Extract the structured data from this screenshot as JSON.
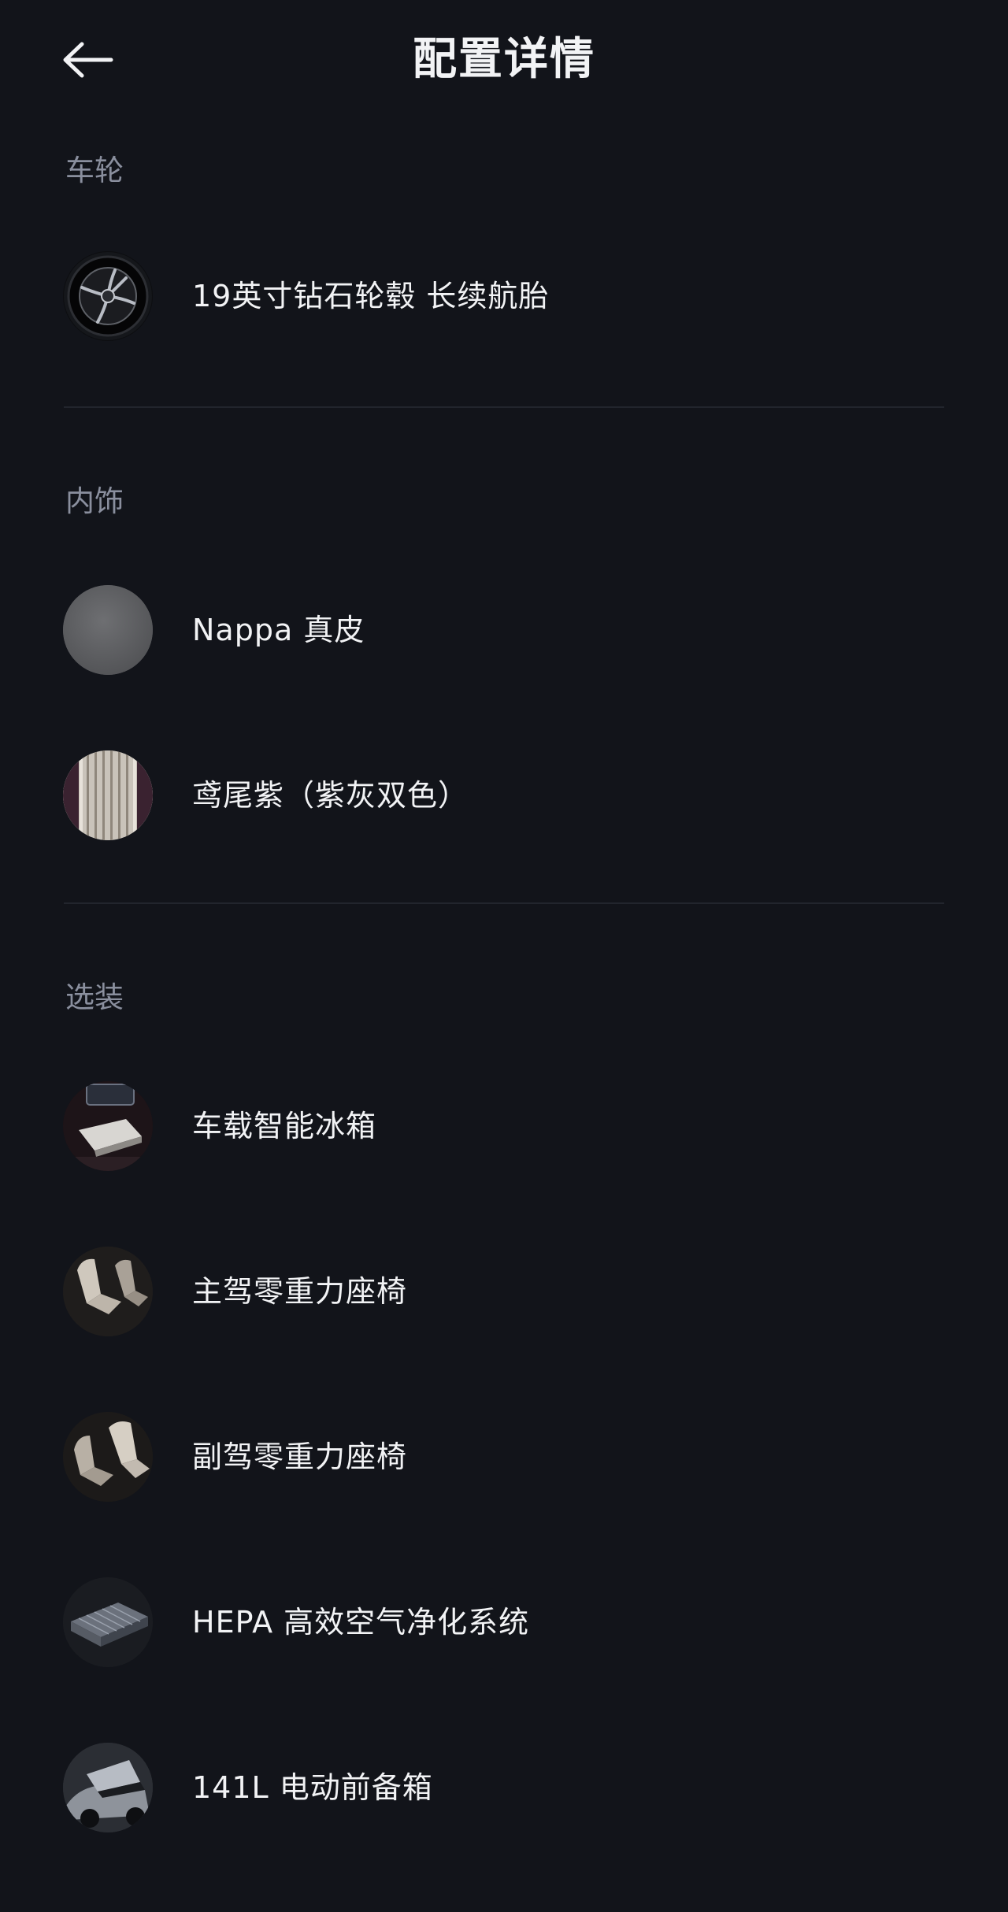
{
  "header": {
    "title": "配置详情",
    "back_icon": "arrow-left-icon"
  },
  "sections": [
    {
      "title": "车轮",
      "items": [
        {
          "label": "19英寸钻石轮毂 长续航胎",
          "icon": "wheel-thumbnail"
        }
      ]
    },
    {
      "title": "内饰",
      "items": [
        {
          "label": "Nappa 真皮",
          "icon": "leather-swatch-thumbnail"
        },
        {
          "label": "鸢尾紫（紫灰双色）",
          "icon": "interior-color-swatch-thumbnail"
        }
      ]
    },
    {
      "title": "选装",
      "items": [
        {
          "label": "车载智能冰箱",
          "icon": "fridge-thumbnail"
        },
        {
          "label": "主驾零重力座椅",
          "icon": "driver-seat-thumbnail"
        },
        {
          "label": "副驾零重力座椅",
          "icon": "passenger-seat-thumbnail"
        },
        {
          "label": "HEPA 高效空气净化系统",
          "icon": "air-filter-thumbnail"
        },
        {
          "label": "141L 电动前备箱",
          "icon": "front-trunk-thumbnail"
        }
      ]
    }
  ],
  "colors": {
    "background": "#12141a",
    "text_primary": "#f2f3f5",
    "text_section": "#8a8f9e",
    "divider": "#22252d"
  }
}
